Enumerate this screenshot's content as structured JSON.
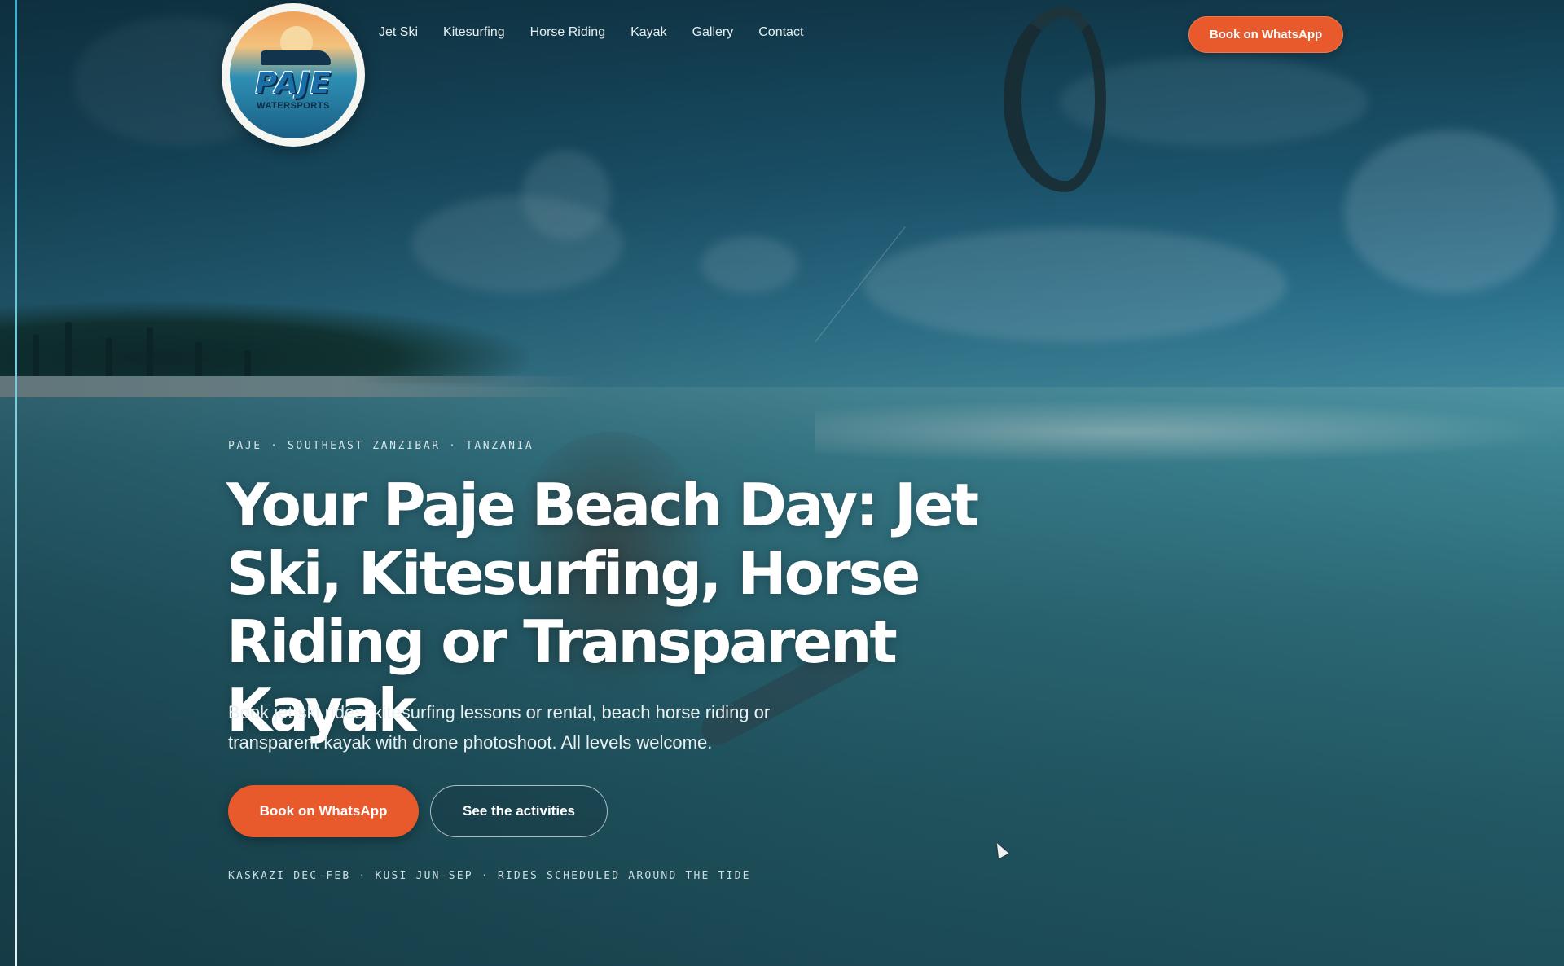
{
  "brand": {
    "logo_text": "PAJE",
    "logo_sub": "WATERSPORTS"
  },
  "nav": {
    "items": [
      {
        "label": "Jet Ski"
      },
      {
        "label": "Kitesurfing"
      },
      {
        "label": "Horse Riding"
      },
      {
        "label": "Kayak"
      },
      {
        "label": "Gallery"
      },
      {
        "label": "Contact"
      }
    ],
    "cta_label": "Book on WhatsApp"
  },
  "hero": {
    "eyebrow": "PAJE · SOUTHEAST ZANZIBAR · TANZANIA",
    "headline": "Your Paje Beach Day: Jet Ski, Kitesurfing, Horse Riding or Transparent Kayak",
    "subtext": "Book jet ski rides, kitesurfing lessons or rental, beach horse riding or transparent kayak with drone photoshoot. All levels welcome.",
    "primary_cta": "Book on WhatsApp",
    "secondary_cta": "See the activities",
    "footnote": "KASKAZI DEC-FEB · KUSI JUN-SEP · RIDES SCHEDULED AROUND THE TIDE"
  },
  "colors": {
    "accent": "#e85a2c",
    "sea": "#2c6a77",
    "sky": "#1c5670"
  },
  "icons": {
    "cursor": "mouse-pointer-icon"
  }
}
